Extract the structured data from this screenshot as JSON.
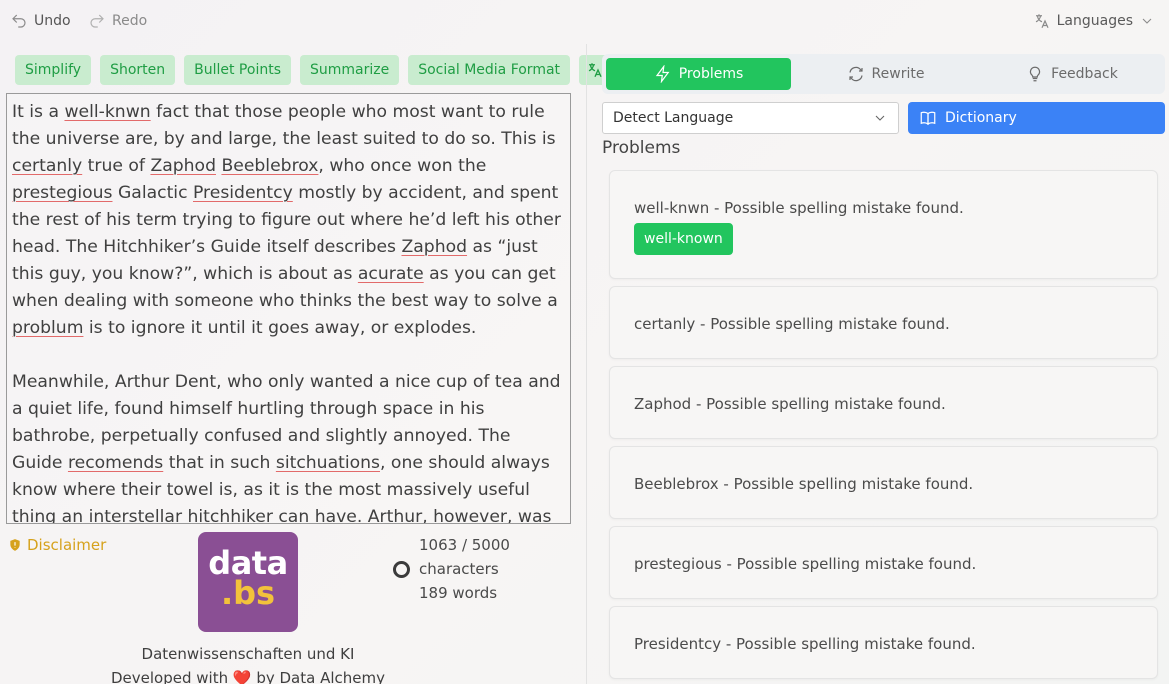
{
  "toolbar": {
    "undo_label": "Undo",
    "redo_label": "Redo",
    "languages_label": "Languages"
  },
  "actions": [
    "Simplify",
    "Shorten",
    "Bullet Points",
    "Summarize",
    "Social Media Format"
  ],
  "editor": {
    "paragraph1": [
      {
        "t": "It is a "
      },
      {
        "t": "well-knwn",
        "err": true
      },
      {
        "t": " fact that those people who most want to rule the universe are, by and large, the least suited to do so. This is "
      },
      {
        "t": "certanly",
        "err": true
      },
      {
        "t": " true of "
      },
      {
        "t": "Zaphod",
        "err": true
      },
      {
        "t": " "
      },
      {
        "t": "Beeblebrox",
        "err": true
      },
      {
        "t": ", who once won the "
      },
      {
        "t": "prestegious",
        "err": true
      },
      {
        "t": " Galactic "
      },
      {
        "t": "Presidentcy",
        "err": true
      },
      {
        "t": " mostly by accident, and spent the rest of his term trying to figure out where he’d left his other head. The Hitchhiker’s Guide itself describes "
      },
      {
        "t": "Zaphod",
        "err": true
      },
      {
        "t": " as “just this guy, you know?”, which is about as "
      },
      {
        "t": "acurate",
        "err": true
      },
      {
        "t": " as you can get when dealing with someone who thinks the best way to solve a "
      },
      {
        "t": "problum",
        "err": true
      },
      {
        "t": " is to ignore it until it goes away, or explodes."
      }
    ],
    "paragraph2": [
      {
        "t": "Meanwhile, Arthur Dent, who only wanted a nice cup of tea and a quiet life, found himself hurtling through space in his bathrobe, perpetually confused and slightly annoyed. The Guide "
      },
      {
        "t": "recomends",
        "err": true
      },
      {
        "t": " that in such "
      },
      {
        "t": "sitchuations",
        "err": true
      },
      {
        "t": ", one should always know where their towel is, as it is the most massively useful thing an interstellar hitchhiker can have. Arthur, however, was still trying to figure out how to"
      }
    ]
  },
  "disclaimer_label": "Disclaimer",
  "logo": {
    "line1": "data",
    "line2": ".bs"
  },
  "counter": {
    "chars": "1063 / 5000",
    "chars_label": "characters",
    "words": "189 words"
  },
  "credits": {
    "line1": "Datenwissenschaften und KI",
    "line2_pre": "Developed with",
    "heart": "❤️",
    "line2_post": "by Data Alchemy"
  },
  "tabs": {
    "problems": "Problems",
    "rewrite": "Rewrite",
    "feedback": "Feedback"
  },
  "language_select": {
    "value": "Detect Language"
  },
  "dictionary_label": "Dictionary",
  "problems_title": "Problems",
  "problems": [
    {
      "text": "well-knwn - Possible spelling mistake found.",
      "suggestion": "well-known"
    },
    {
      "text": "certanly - Possible spelling mistake found."
    },
    {
      "text": "Zaphod - Possible spelling mistake found."
    },
    {
      "text": "Beeblebrox - Possible spelling mistake found."
    },
    {
      "text": "prestegious - Possible spelling mistake found."
    },
    {
      "text": "Presidentcy - Possible spelling mistake found."
    }
  ],
  "colors": {
    "green": "#22c55e",
    "pill_bg": "#c9eccf",
    "blue": "#3b82f6",
    "warning": "#d6a21c",
    "logo_bg": "#8a4f94"
  }
}
